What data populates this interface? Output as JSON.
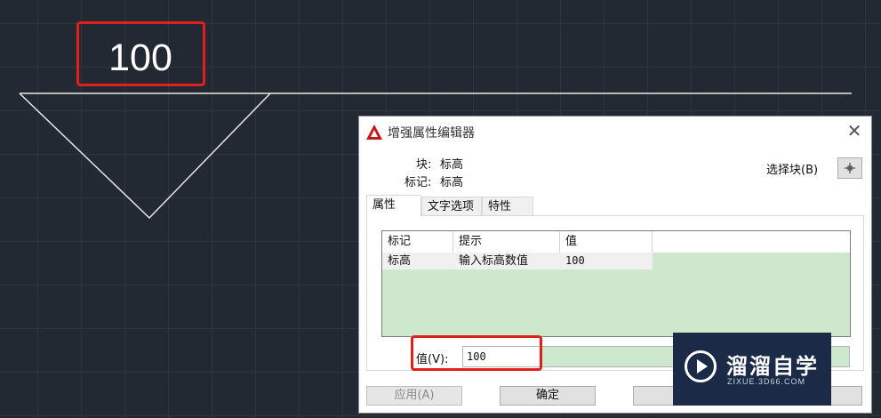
{
  "canvas": {
    "elevation_text": "100"
  },
  "dialog": {
    "title": "增强属性编辑器",
    "close_symbol": "✕",
    "block_label": "块:",
    "block_value": "标高",
    "tag_label": "标记:",
    "tag_value": "标高",
    "select_block_label": "选择块(B)",
    "select_block_icon": "pick-point-icon",
    "tabs": [
      {
        "label": "属性",
        "active": true
      },
      {
        "label": "文字选项",
        "active": false
      },
      {
        "label": "特性",
        "active": false
      }
    ],
    "table": {
      "columns": [
        "标记",
        "提示",
        "值"
      ],
      "rows": [
        {
          "tag": "标高",
          "prompt": "输入标高数值",
          "value": "100"
        }
      ]
    },
    "value_label": "值(V):",
    "value_input": "100",
    "buttons": {
      "apply": "应用(A)",
      "ok": "确定",
      "cancel": "取",
      "help": "助"
    }
  },
  "watermark": {
    "title": "溜溜自学",
    "url": "ZIXUE.3D66.COM"
  },
  "colors": {
    "canvas_bg": "#222932",
    "highlight_red": "#e0201c",
    "table_green": "#cde8cd",
    "watermark_bg": "#1b2a46"
  }
}
